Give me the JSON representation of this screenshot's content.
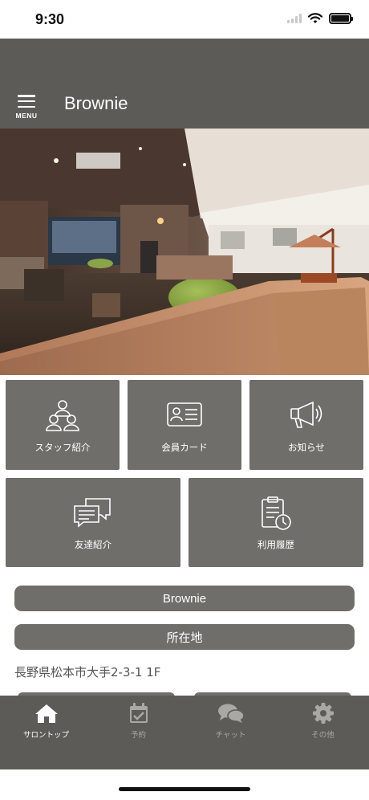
{
  "status_bar": {
    "time": "9:30"
  },
  "header": {
    "menu_label": "MENU",
    "title": "Brownie"
  },
  "hero": {
    "image_desc": "salon-interior-photo"
  },
  "tiles": [
    {
      "label": "スタッフ紹介",
      "icon": "staff-icon"
    },
    {
      "label": "会員カード",
      "icon": "member-card-icon"
    },
    {
      "label": "お知らせ",
      "icon": "megaphone-icon"
    },
    {
      "label": "友達紹介",
      "icon": "chat-bubbles-icon"
    },
    {
      "label": "利用履歴",
      "icon": "clipboard-clock-icon"
    }
  ],
  "info": {
    "shop_button": "Brownie",
    "location_button": "所在地",
    "address": "長野県松本市大手2-3-1 1F"
  },
  "tabbar": {
    "items": [
      {
        "label": "サロントップ",
        "icon": "home-icon",
        "active": true
      },
      {
        "label": "予約",
        "icon": "calendar-check-icon",
        "active": false
      },
      {
        "label": "チャット",
        "icon": "chat-icon",
        "active": false
      },
      {
        "label": "その他",
        "icon": "gear-icon",
        "active": false
      }
    ]
  },
  "colors": {
    "header_bg": "#5c5b57",
    "tile_bg": "#6f6e6b",
    "tab_active": "#ffffff",
    "tab_inactive": "#a9a8a4"
  }
}
